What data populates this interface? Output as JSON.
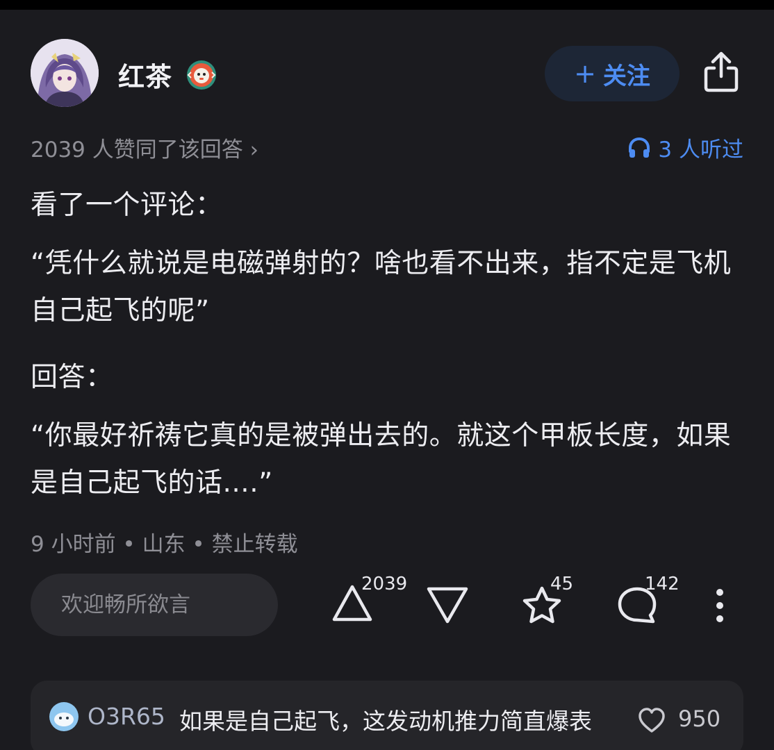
{
  "author": {
    "name": "红茶",
    "avatar": "anime-character-avatar",
    "badge": "creator-badge-icon"
  },
  "header": {
    "follow_label": "关注",
    "follow_icon": "plus-icon",
    "share_icon": "share-icon"
  },
  "stats": {
    "agree_text": "2039 人赞同了该回答 ›",
    "listened_text": "3 人听过",
    "listened_icon": "headphones-icon"
  },
  "content": {
    "p1": "看了一个评论：",
    "p2": "“凭什么就说是电磁弹射的？啥也看不出来，指不定是飞机自己起飞的呢”",
    "p3": "回答：",
    "p4": "“你最好祈祷它真的是被弹出去的。就这个甲板长度，如果是自己起飞的话....”"
  },
  "meta": {
    "text": "9 小时前 • 山东 • 禁止转载"
  },
  "actions": {
    "comment_placeholder": "欢迎畅所欲言",
    "upvote_count": "2039",
    "favorite_count": "45",
    "comment_count": "142"
  },
  "preview_comment": {
    "user": "O3R65",
    "text": "如果是自己起飞，这发动机推力简直爆表",
    "likes": "950"
  },
  "colors": {
    "background": "#1b1b1f",
    "accent": "#4d8cf2",
    "muted": "#8f8f96"
  }
}
